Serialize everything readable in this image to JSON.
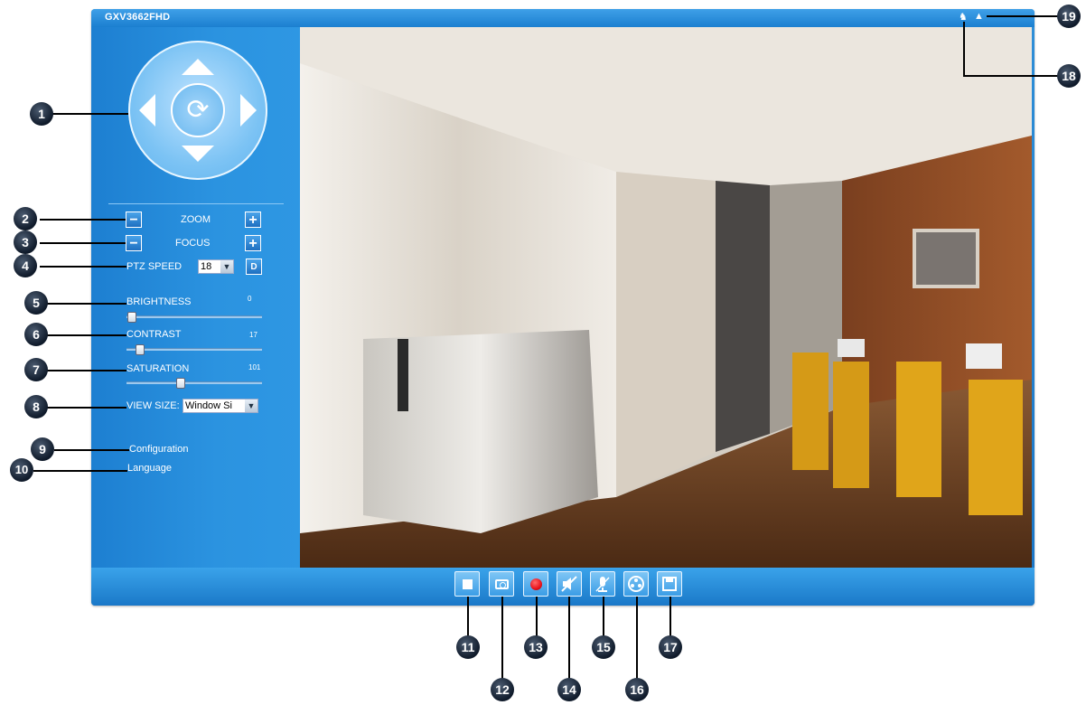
{
  "window": {
    "title": "GXV3662FHD"
  },
  "ptz": {
    "center_glyph": "⟳"
  },
  "controls": {
    "zoom_label": "ZOOM",
    "focus_label": "FOCUS",
    "minus": "−",
    "plus": "+",
    "ptz_speed_label": "PTZ SPEED",
    "ptz_speed_value": "18",
    "ptz_speed_button": "D",
    "brightness_label": "BRIGHTNESS",
    "brightness_value": "0",
    "contrast_label": "CONTRAST",
    "contrast_value": "17",
    "saturation_label": "SATURATION",
    "saturation_value": "101",
    "view_size_label": "VIEW SIZE:",
    "view_size_value": "Window Si"
  },
  "links": {
    "configuration": "Configuration",
    "language": "Language"
  },
  "toolbar": [
    "stop",
    "snapshot",
    "record",
    "mute",
    "microphone",
    "reel",
    "save"
  ],
  "callouts": [
    "1",
    "2",
    "3",
    "4",
    "5",
    "6",
    "7",
    "8",
    "9",
    "10",
    "11",
    "12",
    "13",
    "14",
    "15",
    "16",
    "17",
    "18",
    "19"
  ],
  "colors": {
    "frame": "#1f7fcf",
    "record": "#e8121c",
    "badge": "#1a2638"
  }
}
